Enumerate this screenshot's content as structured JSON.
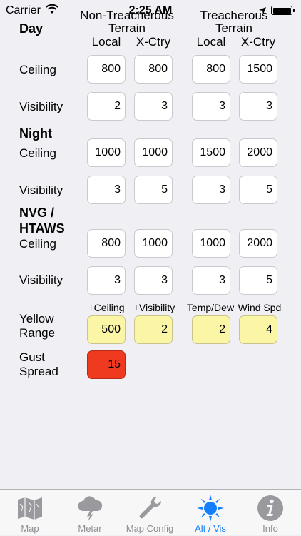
{
  "status_bar": {
    "carrier": "Carrier",
    "time": "2:25 AM"
  },
  "headers": {
    "non_treacherous": "Non-Treacherous\nTerrain",
    "treacherous": "Treacherous\nTerrain",
    "local": "Local",
    "xctry": "X-Ctry"
  },
  "sections": {
    "day": "Day",
    "night": "Night",
    "nvg": "NVG /\nHTAWS"
  },
  "labels": {
    "ceiling": "Ceiling",
    "visibility": "Visibility",
    "yellow_range": "Yellow\nRange",
    "gust_spread": "Gust\nSpread"
  },
  "day": {
    "ceiling": [
      "800",
      "800",
      "800",
      "1500"
    ],
    "visibility": [
      "2",
      "3",
      "3",
      "3"
    ]
  },
  "night": {
    "ceiling": [
      "1000",
      "1000",
      "1500",
      "2000"
    ],
    "visibility": [
      "3",
      "5",
      "3",
      "5"
    ]
  },
  "nvg": {
    "ceiling": [
      "800",
      "1000",
      "1000",
      "2000"
    ],
    "visibility": [
      "3",
      "3",
      "3",
      "5"
    ]
  },
  "yellow": {
    "headers": [
      "+Ceiling",
      "+Visibility",
      "Temp/Dew",
      "Wind Spd"
    ],
    "values": [
      "500",
      "2",
      "2",
      "4"
    ]
  },
  "gust": {
    "value": "15"
  },
  "colors": {
    "yellow": "#fbf6a6",
    "red": "#ef3a1f",
    "active_tab": "#147efb",
    "inactive_tab": "#8e8e93"
  },
  "tabs": [
    {
      "label": "Map",
      "icon": "map-icon"
    },
    {
      "label": "Metar",
      "icon": "storm-cloud-icon"
    },
    {
      "label": "Map Config",
      "icon": "wrench-icon"
    },
    {
      "label": "Alt / Vis",
      "icon": "sun-icon",
      "active": true
    },
    {
      "label": "Info",
      "icon": "info-icon"
    }
  ]
}
